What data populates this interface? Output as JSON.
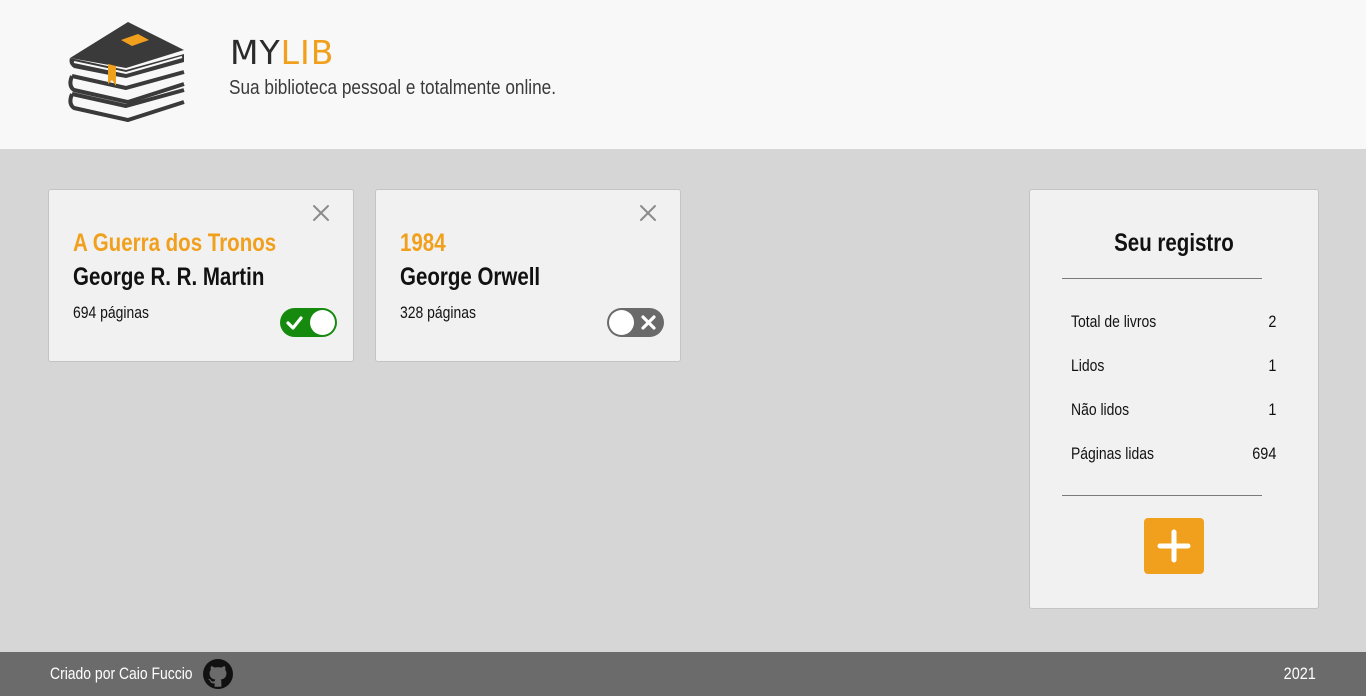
{
  "header": {
    "brand_my": "MY",
    "brand_lib": "LIB",
    "tagline": "Sua biblioteca pessoal e totalmente online.",
    "logo_icon": "books-stack-icon"
  },
  "books": [
    {
      "title": "A Guerra dos Tronos",
      "author": "George R. R. Martin",
      "pages": "694 páginas",
      "read": true
    },
    {
      "title": "1984",
      "author": "George Orwell",
      "pages": "328 páginas",
      "read": false
    }
  ],
  "stats": {
    "title": "Seu registro",
    "rows": [
      {
        "label": "Total de livros",
        "value": "2"
      },
      {
        "label": "Lidos",
        "value": "1"
      },
      {
        "label": "Não lidos",
        "value": "1"
      },
      {
        "label": "Páginas lidas",
        "value": "694"
      }
    ],
    "add_icon": "plus-icon"
  },
  "footer": {
    "credit": "Criado por Caio Fuccio",
    "github_icon": "github-icon",
    "year": "2021"
  },
  "colors": {
    "accent": "#f1a01d",
    "toggle_on": "#168a0f",
    "toggle_off": "#6a6a6a",
    "footer_bg": "#6b6b6b",
    "page_bg": "#d6d6d6"
  }
}
